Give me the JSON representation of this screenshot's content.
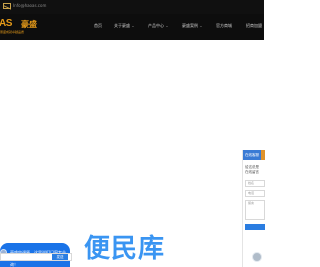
{
  "topbar": {
    "email": "Info@haoas.com",
    "mail_icon": "mail-icon"
  },
  "brand": {
    "mark": "AS",
    "name_cn": "豪盛",
    "tagline": "豪盛成就卓越品质"
  },
  "nav": {
    "items": [
      {
        "label": "首页",
        "has_caret": false
      },
      {
        "label": "关于豪盛",
        "has_caret": true
      },
      {
        "label": "产品中心",
        "has_caret": true
      },
      {
        "label": "豪盛案例",
        "has_caret": true
      },
      {
        "label": "官方商城",
        "has_caret": false
      },
      {
        "label": "招商加盟",
        "has_caret": false
      }
    ],
    "caret": "⌄"
  },
  "chat": {
    "message": "豪盛空调原，这里说们门窗专业品牌，我是为您服务，欢迎咨询！",
    "send_label": "发送",
    "close_icon": "close-icon"
  },
  "side_panel": {
    "header": "在线客服",
    "prompt_line1": "给这说是",
    "prompt_line2": "在线留言",
    "field1": "姓名",
    "field2": "电话",
    "field3": "留言"
  },
  "watermark": "便民库",
  "colors": {
    "accent": "#e59a19",
    "chat_blue": "#1a73e8",
    "header_bg": "#0d0d0d"
  }
}
